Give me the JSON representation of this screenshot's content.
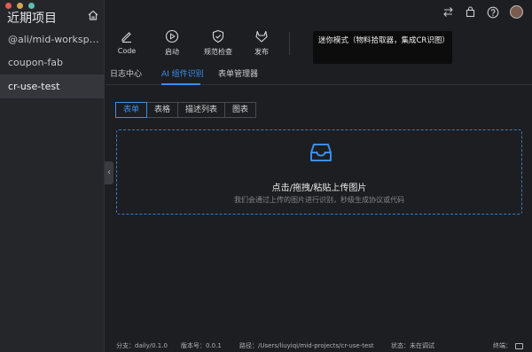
{
  "window": {
    "traffic_colors": [
      "#e25b53",
      "#d2a650",
      "#5bbfb4"
    ]
  },
  "sidebar": {
    "title": "近期项目",
    "home_icon": "home-icon",
    "projects": [
      {
        "label": "@ali/mid-workspace-..."
      },
      {
        "label": "coupon-fab"
      },
      {
        "label": "cr-use-test",
        "active": true
      }
    ]
  },
  "topbar": {
    "icons": [
      "swap-icon",
      "bag-icon",
      "help-icon",
      "avatar"
    ]
  },
  "toolbar": {
    "items": [
      {
        "label": "Code",
        "icon": "edit-icon"
      },
      {
        "label": "启动",
        "icon": "play-icon"
      },
      {
        "label": "规范检查",
        "icon": "shield-check-icon"
      },
      {
        "label": "发布",
        "icon": "gitlab-icon"
      }
    ]
  },
  "tooltip": {
    "text": "迷你模式（物料拾取器，集成CR识图）"
  },
  "tabs": [
    {
      "label": "日志中心"
    },
    {
      "label": "AI 组件识别",
      "active": true
    },
    {
      "label": "表单管理器"
    }
  ],
  "segments": [
    {
      "label": "表单",
      "active": true
    },
    {
      "label": "表格"
    },
    {
      "label": "描述列表"
    },
    {
      "label": "图表"
    }
  ],
  "upload": {
    "title": "点击/拖拽/粘贴上传图片",
    "subtitle": "我们会通过上传的图片进行识别，秒级生成协议或代码",
    "icon": "inbox-icon"
  },
  "statusbar": {
    "branch": "分支：daily/0.1.0",
    "version": "版本号：0.0.1",
    "path": "路径：/Users/liuyiqi/mid-projects/cr-use-test",
    "state": "状态：未在调试",
    "terminal": "终端："
  },
  "colors": {
    "accent": "#3a8eef",
    "background": "#1d1e21",
    "sidebar": "#25262a"
  }
}
